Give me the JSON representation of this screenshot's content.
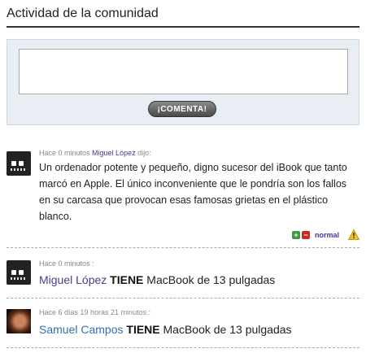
{
  "section": {
    "title": "Actividad de la comunidad"
  },
  "comment_form": {
    "textarea_value": "",
    "button_label": "¡COMENTA!"
  },
  "activity": [
    {
      "meta_time": "Hace 0 minutos",
      "meta_user": "Miguel López",
      "meta_suffix": " dijo:",
      "text": "Un ordenador potente y pequeño, digno sucesor del iBook que tanto marcó en Apple. El único inconveniente que le pondría son los fallos en su carcasa que provocan esas famosas grietas en el plástico blanco.",
      "rating_label": "normal",
      "vote_up": "+",
      "vote_down": "−"
    },
    {
      "meta": "Hace 0 minutos :",
      "user": "Miguel López",
      "verb": "TIENE",
      "object": "MacBook de 13 pulgadas"
    },
    {
      "meta": "Hace 6 días 19 horas 21 minutos :",
      "user": "Samuel Campos",
      "verb": "TIENE",
      "object": "MacBook de 13 pulgadas"
    }
  ],
  "colors": {
    "accent_purple": "#4b3c8c",
    "accent_blue": "#2f6fb0",
    "vote_up": "#3a9a3a",
    "vote_down": "#c8282a",
    "warning": "#f0c419"
  },
  "icons": [
    "robot-avatar-icon",
    "photo-avatar-icon",
    "vote-up-icon",
    "vote-down-icon",
    "warning-icon",
    "resize-grip-icon"
  ]
}
